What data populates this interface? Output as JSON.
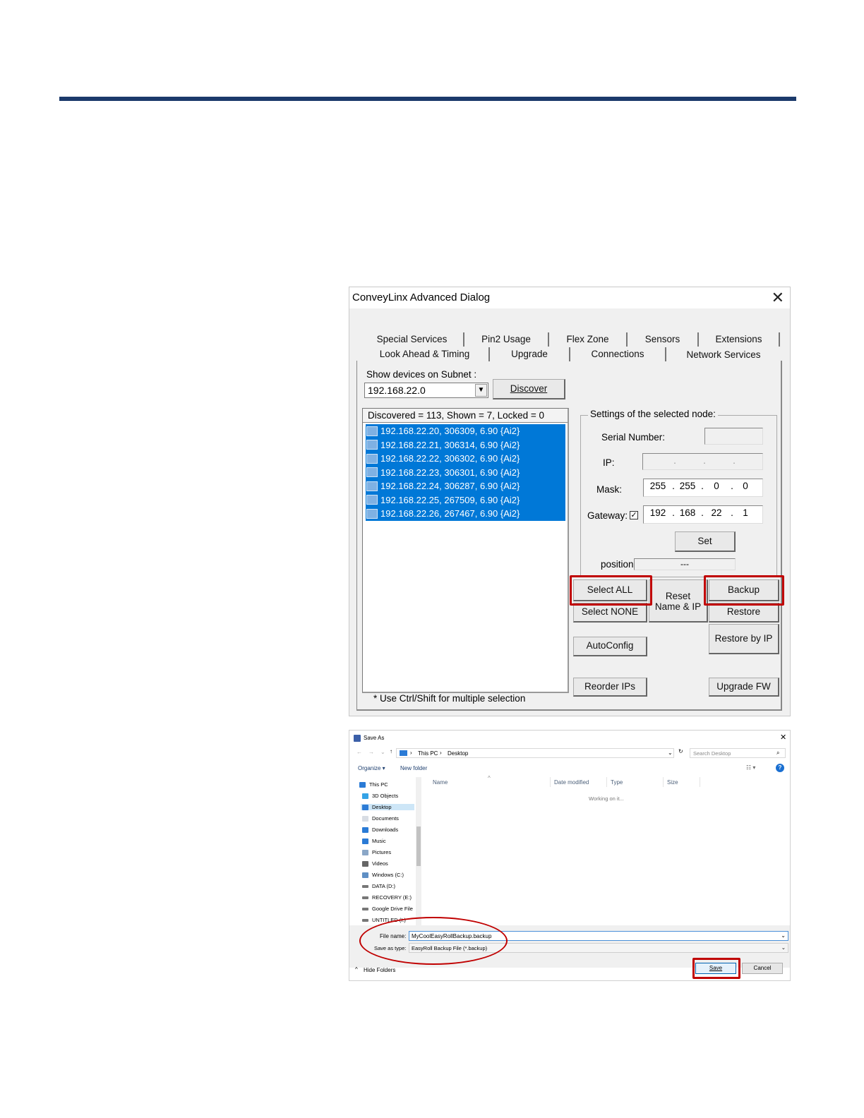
{
  "advanced_dialog": {
    "title": "ConveyLinx Advanced Dialog",
    "close_glyph": "✕",
    "tabs_row1": [
      "Special Services",
      "Pin2 Usage",
      "Flex Zone",
      "Sensors",
      "Extensions"
    ],
    "tabs_row2": [
      "Look Ahead & Timing",
      "Upgrade",
      "Connections",
      "Network Services"
    ],
    "selected_tab": "Network Services",
    "subnet_label": "Show devices on Subnet :",
    "subnet_value": "192.168.22.0",
    "discover_label": "Discover",
    "list_header": "Discovered = 113, Shown = 7, Locked = 0",
    "devices": [
      "192.168.22.20, 306309, 6.90 {Ai2}",
      "192.168.22.21, 306314, 6.90 {Ai2}",
      "192.168.22.22, 306302, 6.90 {Ai2}",
      "192.168.22.23, 306301, 6.90 {Ai2}",
      "192.168.22.24, 306287, 6.90 {Ai2}",
      "192.168.22.25, 267509, 6.90 {Ai2}",
      "192.168.22.26, 267467, 6.90 {Ai2}"
    ],
    "hint": "* Use Ctrl/Shift for multiple selection",
    "settings_label": "Settings of the selected node:",
    "serial_label": "Serial Number:",
    "ip_label": "IP:",
    "mask_label": "Mask:",
    "gateway_label": "Gateway:",
    "gateway_checked": "✓",
    "mask": [
      "255",
      "255",
      "0",
      "0"
    ],
    "gateway": [
      "192",
      "168",
      "22",
      "1"
    ],
    "ip_dots": ".",
    "set_label": "Set",
    "position_label": "position:",
    "position_value": "---",
    "buttons": {
      "select_all": "Select ALL",
      "select_none": "Select NONE",
      "reset_line1": "Reset",
      "reset_line2": "Name & IP",
      "backup": "Backup",
      "restore": "Restore",
      "restore_by_ip": "Restore by IP",
      "autoconfig": "AutoConfig",
      "reorder_ips": "Reorder IPs",
      "upgrade_fw": "Upgrade FW"
    },
    "highlight_color": "#c00000",
    "selection_color": "#0078d7"
  },
  "save_dialog": {
    "title": "Save As",
    "close_glyph": "✕",
    "breadcrumb": [
      "This PC",
      "Desktop"
    ],
    "search_placeholder": "Search Desktop",
    "organize": "Organize ▾",
    "new_folder": "New folder",
    "columns": [
      "Name",
      "Date modified",
      "Type",
      "Size"
    ],
    "working": "Working on it...",
    "tree": [
      "This PC",
      "3D Objects",
      "Desktop",
      "Documents",
      "Downloads",
      "Music",
      "Pictures",
      "Videos",
      "Windows (C:)",
      "DATA (D:)",
      "RECOVERY (E:)",
      "Google Drive File",
      "UNTITLED (I:)"
    ],
    "selected_tree_item": "Desktop",
    "file_name_label": "File name:",
    "file_name_value": "MyCoolEasyRollBackup.backup",
    "save_type_label": "Save as type:",
    "save_type_value": "EasyRoll Backup File  (*.backup)",
    "hide_folders": "Hide Folders",
    "save": "Save",
    "cancel": "Cancel"
  }
}
